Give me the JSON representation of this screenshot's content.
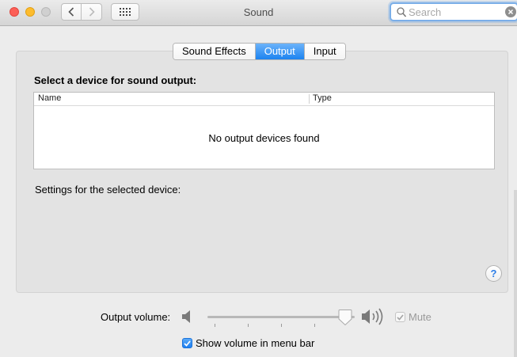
{
  "window": {
    "title": "Sound"
  },
  "search": {
    "placeholder": "Search"
  },
  "tabs": [
    {
      "label": "Sound Effects",
      "selected": false
    },
    {
      "label": "Output",
      "selected": true
    },
    {
      "label": "Input",
      "selected": false
    }
  ],
  "output": {
    "heading": "Select a device for sound output:",
    "columns": [
      "Name",
      "Type"
    ],
    "empty_message": "No output devices found",
    "settings_label": "Settings for the selected device:"
  },
  "volume": {
    "label": "Output volume:",
    "level": 0.9,
    "mute_label": "Mute",
    "mute_checked": true,
    "mute_enabled": false,
    "menubar_label": "Show volume in menu bar",
    "menubar_checked": true
  },
  "icons": {
    "close": "close-icon",
    "minimize": "minimize-icon",
    "zoom": "zoom-icon",
    "back": "chevron-left-icon",
    "forward": "chevron-right-icon",
    "grid": "grid-icon",
    "search": "search-icon",
    "clear": "clear-icon",
    "help": "help-icon",
    "speaker_low": "speaker-low-icon",
    "speaker_high": "speaker-high-icon"
  },
  "colors": {
    "accent": "#1c83f0",
    "help": "#2d7de6"
  }
}
